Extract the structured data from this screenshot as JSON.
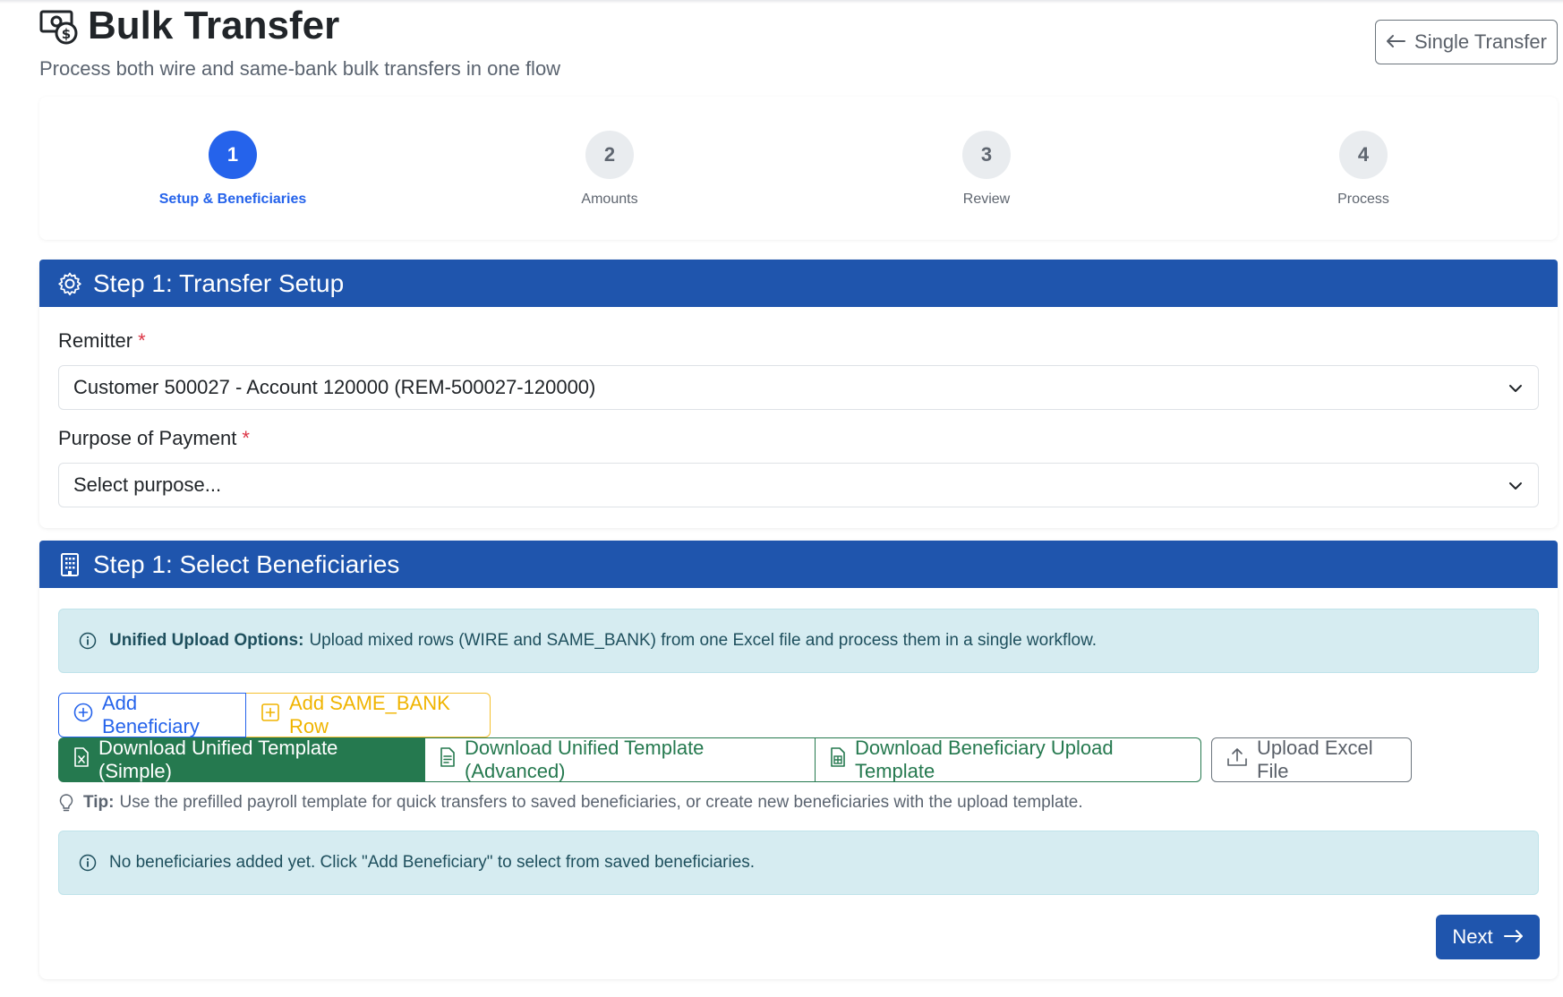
{
  "page": {
    "title": "Bulk Transfer",
    "title_icon": "cash-coin-icon",
    "subtitle": "Process both wire and same-bank bulk transfers in one flow",
    "single_transfer_label": "Single Transfer"
  },
  "stepper": {
    "steps": [
      {
        "number": "1",
        "label": "Setup & Beneficiaries",
        "active": true
      },
      {
        "number": "2",
        "label": "Amounts",
        "active": false
      },
      {
        "number": "3",
        "label": "Review",
        "active": false
      },
      {
        "number": "4",
        "label": "Process",
        "active": false
      }
    ]
  },
  "setup": {
    "header": "Step 1: Transfer Setup",
    "header_icon": "gear-icon",
    "remitter_label": "Remitter",
    "remitter_value": "Customer 500027 - Account 120000 (REM-500027-120000)",
    "purpose_label": "Purpose of Payment",
    "purpose_value": "Select purpose...",
    "required_mark": "*"
  },
  "beneficiaries": {
    "header": "Step 1: Select Beneficiaries",
    "header_icon": "building-icon",
    "info_title": "Unified Upload Options:",
    "info_text": "Upload mixed rows (WIRE and SAME_BANK) from one Excel file and process them in a single workflow.",
    "add_beneficiary": "Add Beneficiary",
    "add_same_bank": "Add SAME_BANK Row",
    "download_simple": "Download Unified Template (Simple)",
    "download_advanced": "Download Unified Template (Advanced)",
    "download_beneficiary": "Download Beneficiary Upload Template",
    "upload_excel": "Upload Excel File",
    "tip_label": "Tip:",
    "tip_text": "Use the prefilled payroll template for quick transfers to saved beneficiaries, or create new beneficiaries with the upload template.",
    "empty_text": "No beneficiaries added yet. Click \"Add Beneficiary\" to select from saved beneficiaries.",
    "next_label": "Next"
  },
  "colors": {
    "primary": "#2563eb",
    "header_bg": "#1f55ad",
    "success": "#25794f",
    "warning": "#f0b400",
    "info_bg": "#d6ecf1",
    "required": "#dc3545"
  }
}
